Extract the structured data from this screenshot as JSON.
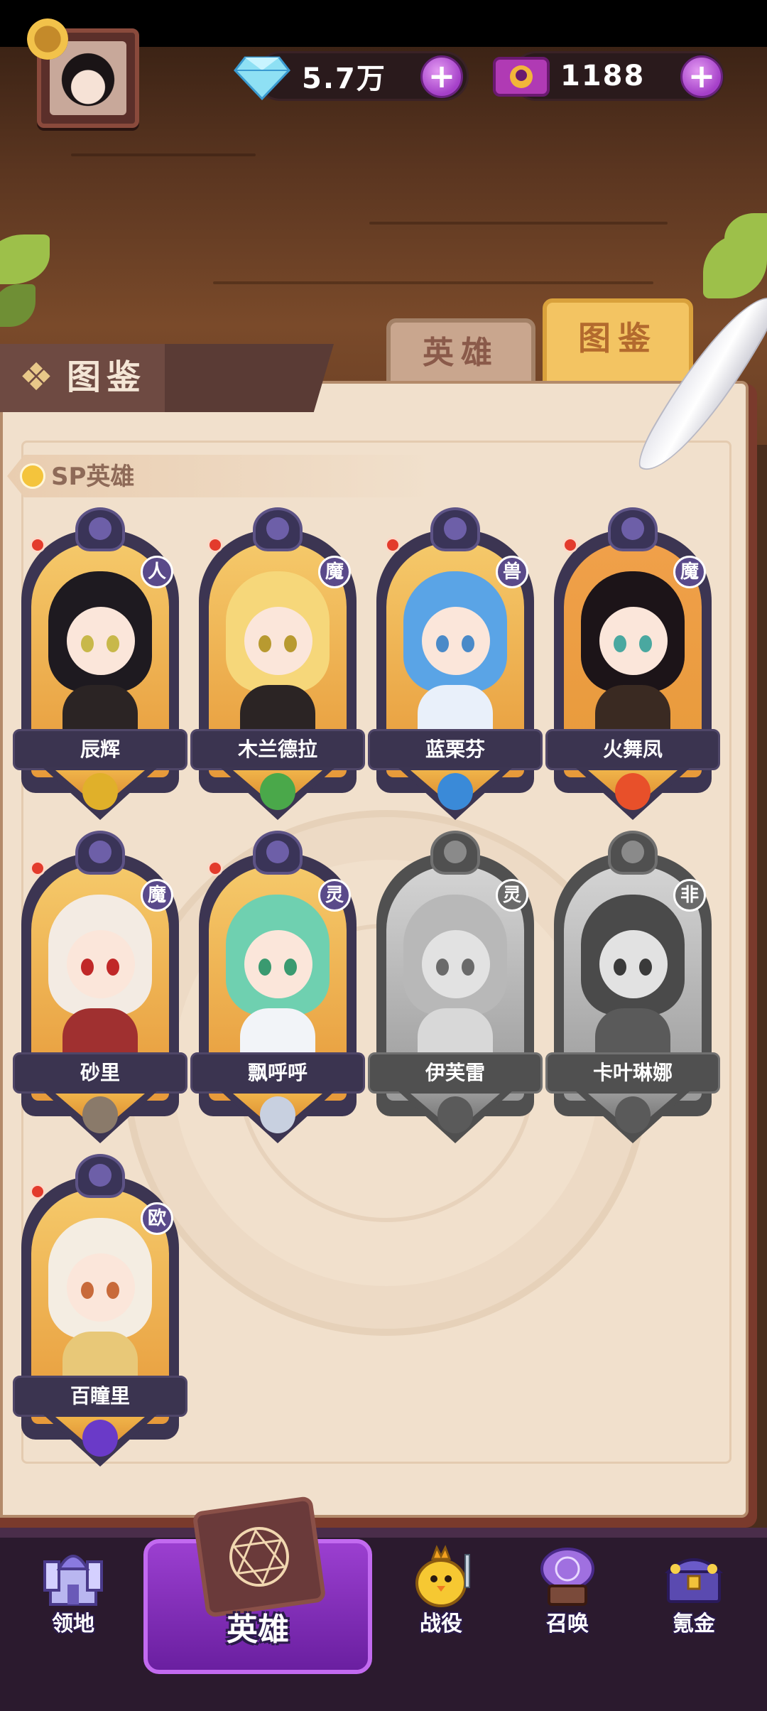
{
  "currency": {
    "gems": "5.7万",
    "tickets": "1188",
    "plus_symbol": "+"
  },
  "tabs": {
    "heroes": "英雄",
    "codex": "图鉴"
  },
  "header": {
    "title": "图鉴"
  },
  "section": {
    "label": "SP英雄"
  },
  "heroes": [
    {
      "name": "辰辉",
      "race": "人",
      "locked": false,
      "element": "earth-crystal-icon",
      "hair": "#1e1a20",
      "outfit": "#2b2424",
      "eyes": "#c8b84a",
      "bg": "#f5c96a"
    },
    {
      "name": "木兰德拉",
      "race": "魔",
      "locked": false,
      "element": "leaf-swirl-icon",
      "hair": "#f6d77a",
      "outfit": "#2b2424",
      "eyes": "#b89a30",
      "bg": "#f5c96a"
    },
    {
      "name": "蓝栗芬",
      "race": "兽",
      "locked": false,
      "element": "water-orb-icon",
      "hair": "#5aa4e6",
      "outfit": "#e9f0fa",
      "eyes": "#4a8ac8",
      "bg": "#f5c96a"
    },
    {
      "name": "火舞凤",
      "race": "魔",
      "locked": false,
      "element": "flame-icon",
      "hair": "#1c1418",
      "outfit": "#3a2a22",
      "eyes": "#4aa8a0",
      "bg": "#f0a04a"
    },
    {
      "name": "砂里",
      "race": "魔",
      "locked": false,
      "element": "rock-icon",
      "hair": "#f3ebe3",
      "outfit": "#a03030",
      "eyes": "#c02828",
      "bg": "#f5c96a"
    },
    {
      "name": "飘呼呼",
      "race": "灵",
      "locked": false,
      "element": "wind-swirl-icon",
      "hair": "#6fd0b0",
      "outfit": "#f2f4f8",
      "eyes": "#3a9a70",
      "bg": "#f5c96a"
    },
    {
      "name": "伊芙雷",
      "race": "灵",
      "locked": true,
      "element": "lightning-icon",
      "hair": "#b8b8b8",
      "outfit": "#d8d8d8",
      "eyes": "#6a6a6a",
      "bg": "#cfcfcf"
    },
    {
      "name": "卡叶琳娜",
      "race": "非",
      "locked": true,
      "element": "lightning-icon",
      "hair": "#4a4a4a",
      "outfit": "#5a5a5a",
      "eyes": "#3a3a3a",
      "bg": "#9a9a9a"
    },
    {
      "name": "百瞳里",
      "race": "欧",
      "locked": false,
      "element": "dark-crystal-icon",
      "hair": "#f4ede2",
      "outfit": "#e8c878",
      "eyes": "#c86a3a",
      "bg": "#f5c96a"
    }
  ],
  "nav": {
    "territory": "领地",
    "heroes": "英雄",
    "campaign": "战役",
    "summon": "召唤",
    "shop": "氪金"
  },
  "colors": {
    "accent": "#a43fc8",
    "book_page": "#f1e0cc",
    "card_frame": "#3c3552",
    "locked_frame": "#505050"
  }
}
